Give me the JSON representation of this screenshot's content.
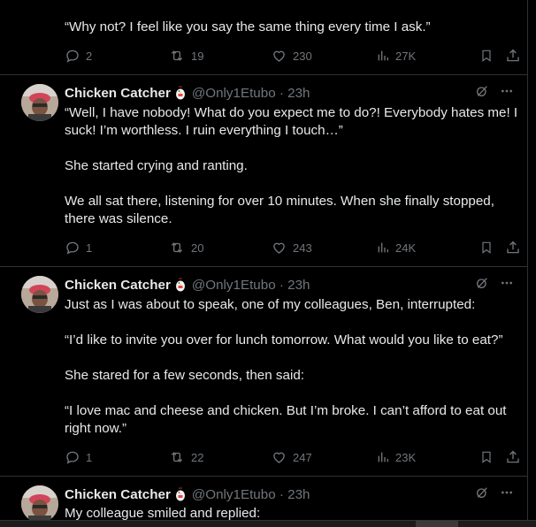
{
  "top_tweet": {
    "text": "“Why not? I feel like you say the same thing every time I ask.”",
    "stats": {
      "replies": "2",
      "reposts": "19",
      "likes": "230",
      "views": "27K"
    }
  },
  "tweets": [
    {
      "name": "Chicken Catcher",
      "handle": "@Only1Etubo · 23h",
      "paragraphs": [
        "“Well, I have nobody! What do you expect me to do?! Everybody hates me! I suck! I’m worthless. I ruin everything I touch…”",
        "She started crying and ranting.",
        "We all sat there, listening for over 10 minutes. When she finally stopped, there was silence."
      ],
      "stats": {
        "replies": "1",
        "reposts": "20",
        "likes": "243",
        "views": "24K"
      }
    },
    {
      "name": "Chicken Catcher",
      "handle": "@Only1Etubo · 23h",
      "paragraphs": [
        "Just as I was about to speak, one of my colleagues, Ben, interrupted:",
        "“I’d like to invite you over for lunch tomorrow. What would you like to eat?”",
        "She stared for a few seconds, then said:",
        "“I love mac and cheese and chicken. But I’m broke. I can’t afford to eat out right now.”"
      ],
      "stats": {
        "replies": "1",
        "reposts": "22",
        "likes": "247",
        "views": "23K"
      }
    },
    {
      "name": "Chicken Catcher",
      "handle": "@Only1Etubo · 23h",
      "paragraphs": [
        "My colleague smiled and replied:"
      ]
    }
  ],
  "colors": {
    "background": "#000000",
    "text": "#e7e9ea",
    "muted": "#71767b",
    "divider": "#2f3336"
  },
  "icons": [
    "reply-icon",
    "repost-icon",
    "like-icon",
    "views-icon",
    "bookmark-icon",
    "share-icon",
    "grok-icon",
    "more-icon",
    "chicken-emoji"
  ]
}
